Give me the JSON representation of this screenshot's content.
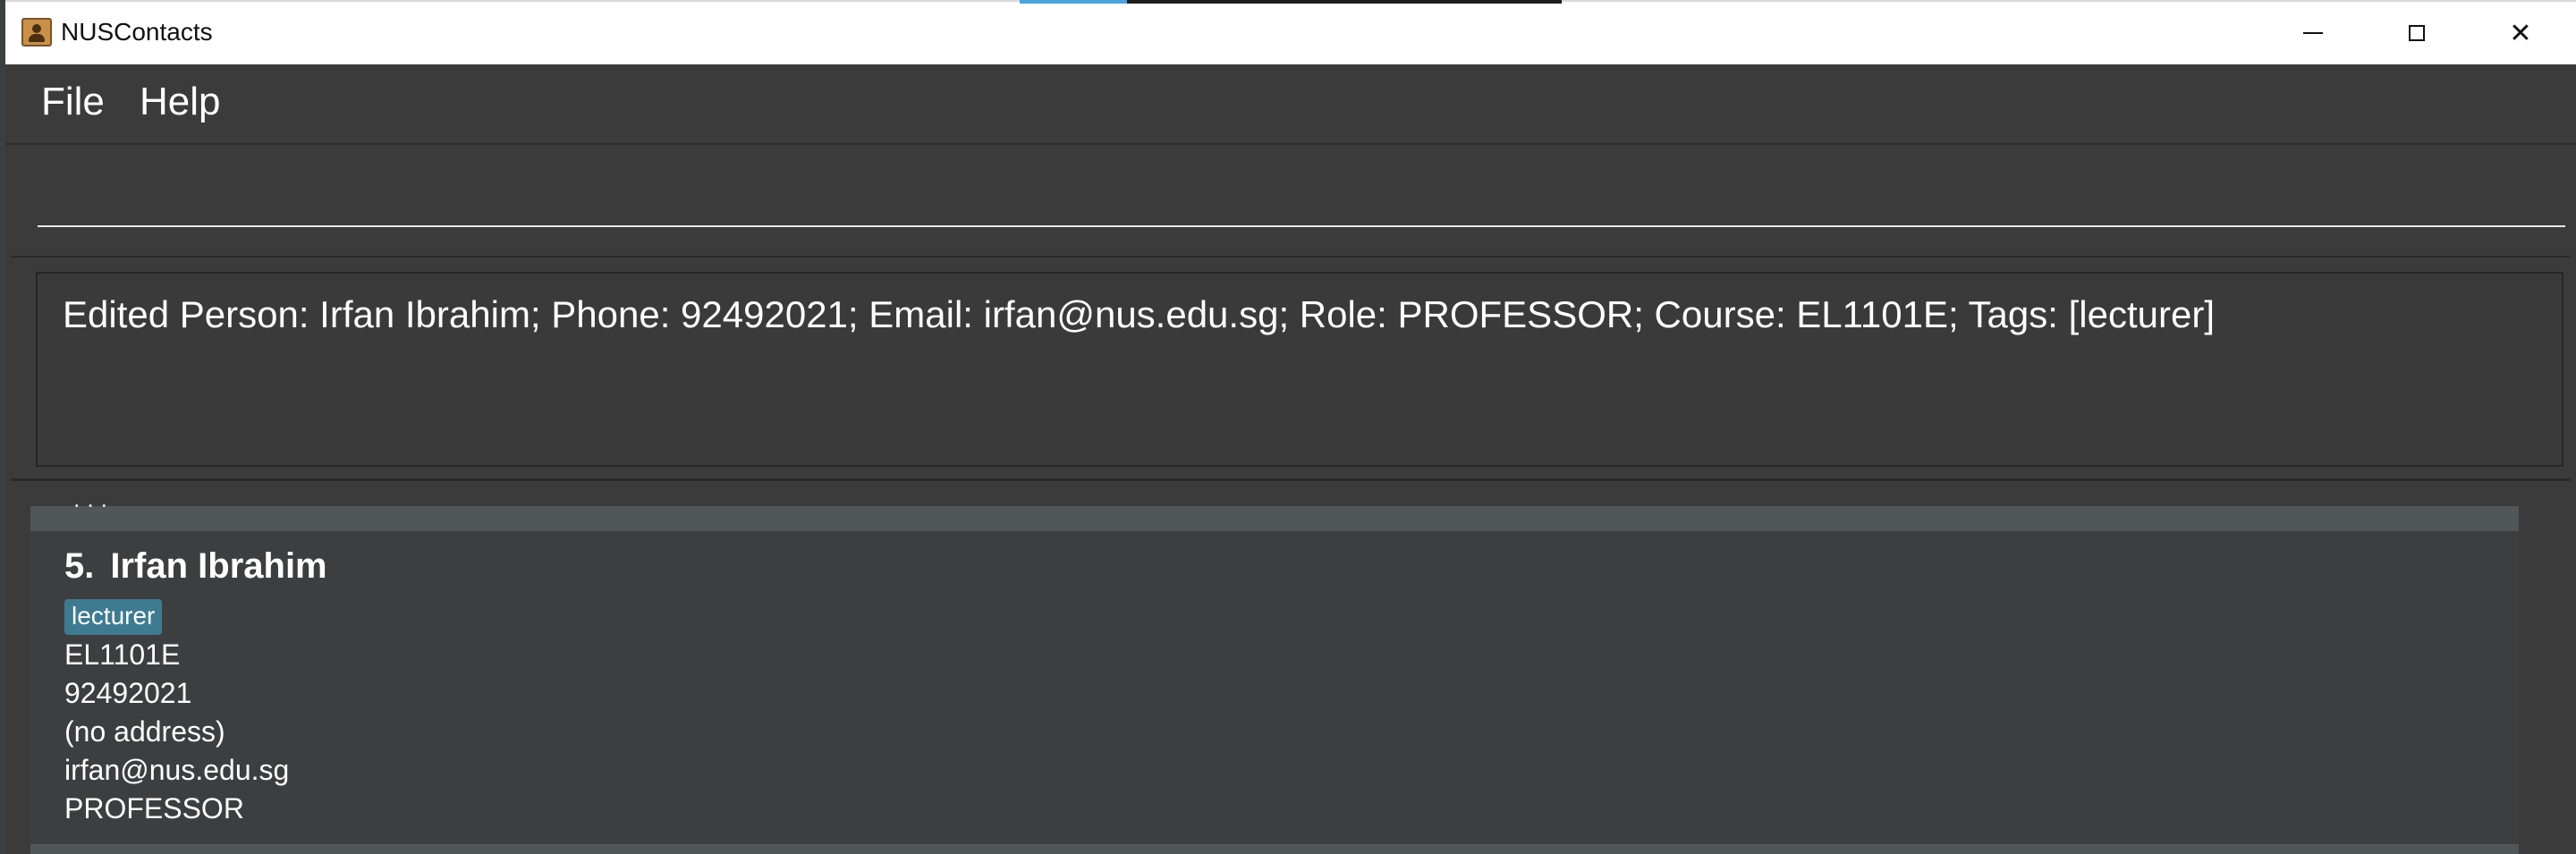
{
  "window": {
    "title": "NUSContacts"
  },
  "menu": {
    "file": "File",
    "help": "Help"
  },
  "command": {
    "value": "",
    "placeholder": ""
  },
  "result": {
    "message": "Edited Person: Irfan Ibrahim; Phone: 92492021; Email: irfan@nus.edu.sg; Role: PROFESSOR; Course: EL1101E; Tags: [lecturer]"
  },
  "person_list": {
    "cut_off_text": "· · ·",
    "persons": [
      {
        "index": "5.",
        "name": "Irfan Ibrahim",
        "tags": [
          "lecturer"
        ],
        "course": "EL1101E",
        "phone": "92492021",
        "address": "(no address)",
        "email": "irfan@nus.edu.sg",
        "role": "PROFESSOR"
      }
    ]
  },
  "colors": {
    "background": "#3b3b3b",
    "tag": "#3e7b91",
    "list_strip": "#515658"
  }
}
